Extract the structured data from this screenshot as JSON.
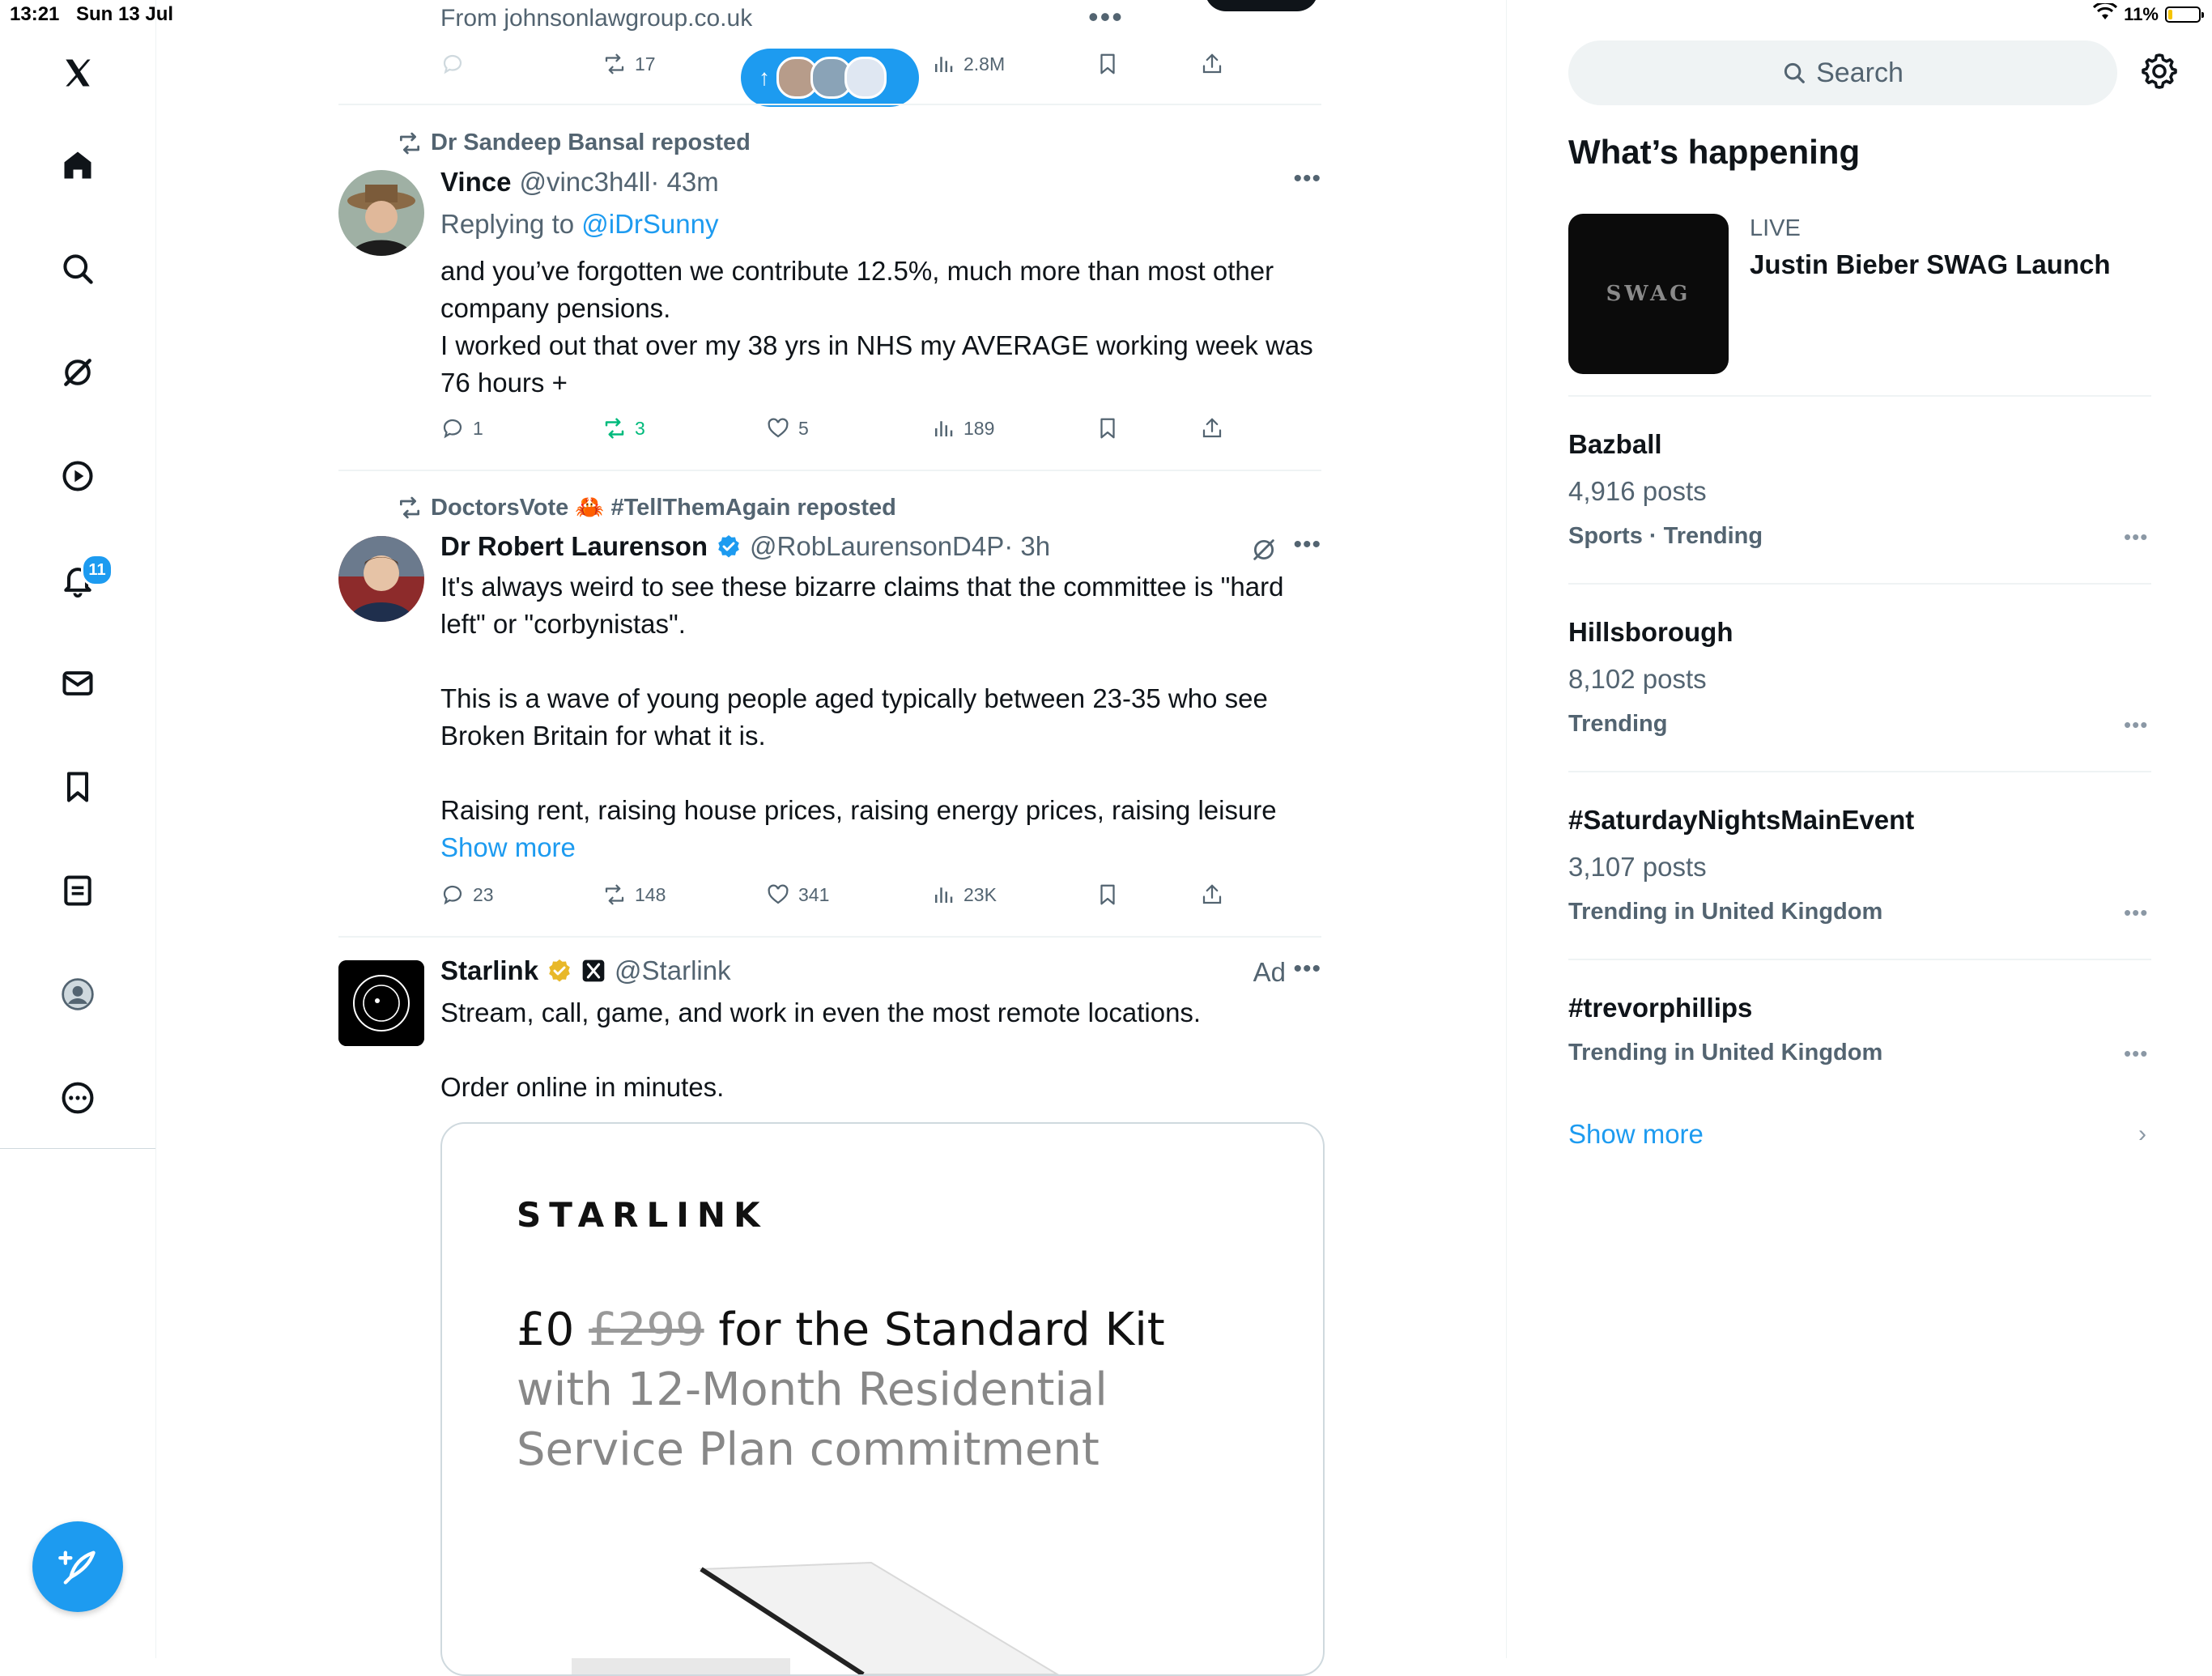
{
  "status_bar": {
    "time": "13:21",
    "date": "Sun 13 Jul",
    "battery": "11%"
  },
  "nav": {
    "notifications_badge": "11"
  },
  "top_tweet": {
    "from": "From johnsonlawgroup.co.uk",
    "retweets": "17",
    "views": "2.8M"
  },
  "tweets": [
    {
      "reposted_by": "Dr Sandeep Bansal reposted",
      "name": "Vince",
      "handle": "@vinc3h4ll",
      "time": "· 43m",
      "replying_prefix": "Replying to ",
      "replying_to": "@iDrSunny",
      "text": "and you’ve forgotten we contribute 12.5%, much more than most other company pensions.\nI worked out that over my 38 yrs in NHS my AVERAGE working week was 76 hours +",
      "replies": "1",
      "retweets": "3",
      "likes": "5",
      "views": "189"
    },
    {
      "reposted_by": "DoctorsVote 🦀 #TellThemAgain reposted",
      "name": "Dr Robert Laurenson",
      "handle": "@RobLaurensonD4P",
      "time": "· 3h",
      "text": "It's always weird to see these bizarre claims that the committee is \"hard left\" or \"corbynistas\".\n\nThis is a wave of young people aged typically between 23-35 who see Broken Britain for what it is.\n\nRaising rent, raising house prices, raising energy prices, raising leisure ",
      "show_more": "Show more",
      "replies": "23",
      "retweets": "148",
      "likes": "341",
      "views": "23K"
    },
    {
      "name": "Starlink",
      "handle": "@Starlink",
      "ad_label": "Ad",
      "text": "Stream, call, game, and work in even the most remote locations.\n\nOrder online in minutes.",
      "card": {
        "brand": "STARLINK",
        "price": "£0",
        "old_price": "£299",
        "headline": "for the Standard Kit",
        "sub1": "with 12-Month Residential",
        "sub2": "Service Plan commitment"
      }
    }
  ],
  "sidebar": {
    "search_placeholder": "Search",
    "heading": "What’s happening",
    "live": {
      "label": "LIVE",
      "title": "Justin Bieber SWAG Launch",
      "thumb_text": "SWAG"
    },
    "trends": [
      {
        "title": "Bazball",
        "count": "4,916 posts",
        "meta": "Sports · Trending"
      },
      {
        "title": "Hillsborough",
        "count": "8,102 posts",
        "meta": "Trending"
      },
      {
        "title": "#SaturdayNightsMainEvent",
        "count": "3,107 posts",
        "meta": "Trending in United Kingdom"
      },
      {
        "title": "#trevorphillips",
        "count": "",
        "meta": "Trending in United Kingdom"
      }
    ],
    "show_more": "Show more"
  },
  "colors": {
    "accent": "#1d9bf0",
    "retweet_green": "#00ba7c",
    "text_secondary": "#536471"
  }
}
